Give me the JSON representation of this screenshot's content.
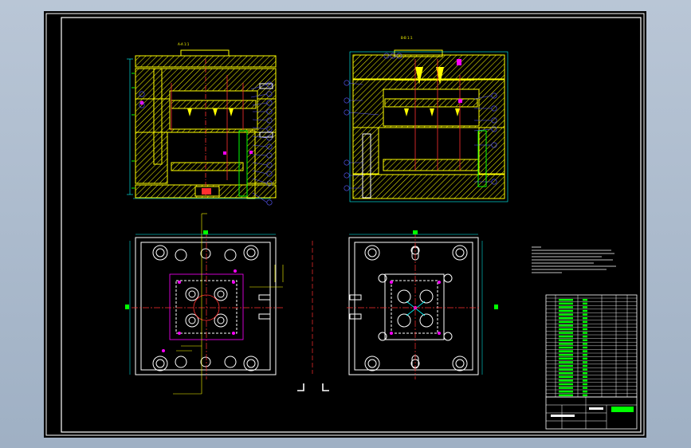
{
  "drawing": {
    "background": "#000000",
    "frame_color": "#ffffff",
    "view_title_left": "A-A 1:1",
    "view_title_right": "B-B 1:1"
  },
  "colors": {
    "yellow": "#ffff00",
    "cyan": "#00ffff",
    "red": "#ff3030",
    "magenta": "#ff00ff",
    "green": "#00ff00",
    "blue": "#5a5aff",
    "white": "#ffffff"
  },
  "icons": {
    "section_marker": "corner-bracket"
  }
}
